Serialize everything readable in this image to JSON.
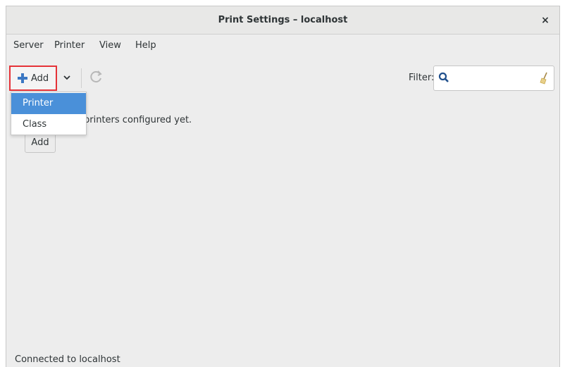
{
  "window": {
    "title": "Print Settings – localhost",
    "close_label": "×"
  },
  "menubar": {
    "items": [
      "Server",
      "Printer",
      "View",
      "Help"
    ]
  },
  "toolbar": {
    "add_label": "Add",
    "filter_label": "Filter:",
    "filter_value": "",
    "icons": {
      "add": "plus-icon",
      "dropdown": "chevron-down-icon",
      "refresh": "refresh-icon",
      "search": "search-icon",
      "clear": "clear-broom-icon"
    }
  },
  "dropdown": {
    "items": [
      "Printer",
      "Class"
    ],
    "selected": "Printer"
  },
  "content": {
    "empty_message": "printers configured yet.",
    "add_button_label": "Add"
  },
  "statusbar": {
    "text": "Connected to localhost"
  },
  "colors": {
    "accent": "#4a90d9",
    "highlight_border": "#e53238",
    "window_bg": "#ededed"
  }
}
